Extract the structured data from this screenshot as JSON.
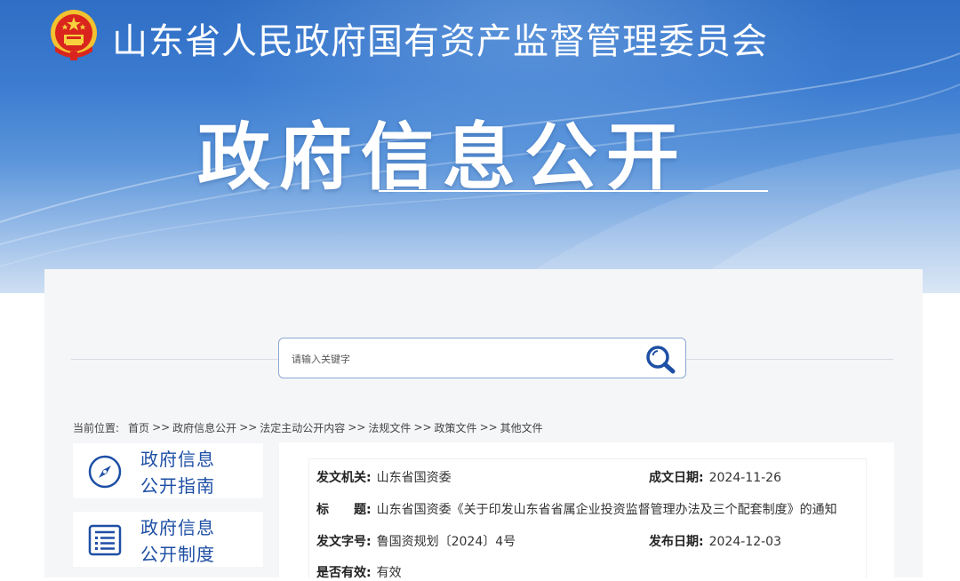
{
  "header": {
    "org_title": "山东省人民政府国有资产监督管理委员会",
    "big_title": "政府信息公开",
    "emblem_icon": "national-emblem-icon"
  },
  "search": {
    "placeholder": "请输入关键字",
    "value": "",
    "button_icon": "search-icon"
  },
  "breadcrumb": {
    "label": "当前位置:",
    "items": [
      "首页",
      "政府信息公开",
      "法定主动公开内容",
      "法规文件",
      "政策文件",
      "其他文件"
    ],
    "separator": ">>"
  },
  "sidebar": {
    "items": [
      {
        "line1": "政府信息",
        "line2": "公开指南",
        "icon": "compass-icon"
      },
      {
        "line1": "政府信息",
        "line2": "公开制度",
        "icon": "document-list-icon"
      }
    ]
  },
  "document": {
    "issuer_label": "发文机关:",
    "issuer": "山东省国资委",
    "created_label": "成文日期:",
    "created": "2024-11-26",
    "title_label": "标　　题:",
    "title": "山东省国资委《关于印发山东省省属企业投资监督管理办法及三个配套制度》的通知",
    "doc_no_label": "发文字号:",
    "doc_no": "鲁国资规划〔2024〕4号",
    "published_label": "发布日期:",
    "published": "2024-12-03",
    "valid_label": "是否有效:",
    "valid": "有效"
  },
  "colors": {
    "banner_top": "#2f6ec4",
    "accent_blue": "#1e4fa5",
    "panel_bg": "#f5f6f8"
  }
}
